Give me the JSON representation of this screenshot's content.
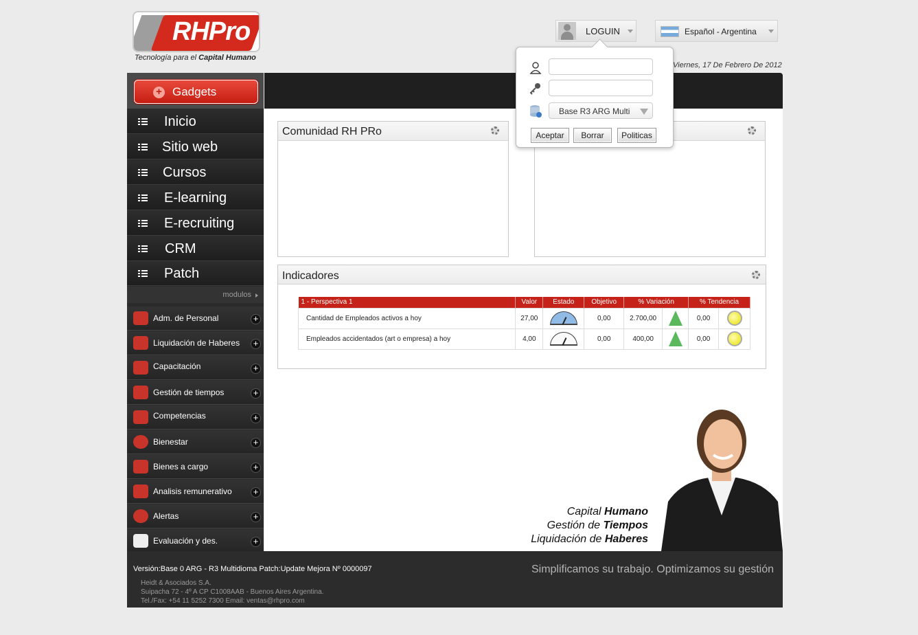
{
  "brand": {
    "logo_text": "RHPro",
    "tagline_prefix": "Tecnología para el ",
    "tagline_bold": "Capital Humano"
  },
  "header": {
    "login_label": "LOGUIN",
    "language_label": "Español - Argentina",
    "date": "Viernes, 17 De Febrero De 2012"
  },
  "login_popup": {
    "user_placeholder": "",
    "password_placeholder": "",
    "database_selected": "Base R3 ARG Multi",
    "accept_label": "Aceptar",
    "clear_label": "Borrar",
    "policies_label": "Politicas"
  },
  "sidebar": {
    "gadgets_label": "Gadgets",
    "nav": [
      {
        "label": "Inicio"
      },
      {
        "label": "Sitio web"
      },
      {
        "label": "Cursos"
      },
      {
        "label": "E-learning"
      },
      {
        "label": "E-recruiting"
      },
      {
        "label": "CRM"
      },
      {
        "label": "Patch"
      }
    ],
    "modulos_label": "modulos",
    "modules": [
      {
        "label": "Adm. de Personal",
        "icon": "people-icon"
      },
      {
        "label": "Liquidación de Haberes",
        "icon": "dollar-icon"
      },
      {
        "label": "Capacitación",
        "icon": "presentation-icon"
      },
      {
        "label": "Gestión de tiempos",
        "icon": "clock-icon"
      },
      {
        "label": "Competencias",
        "icon": "runner-icon"
      },
      {
        "label": "Bienestar",
        "icon": "lifebuoy-icon"
      },
      {
        "label": "Bienes a cargo",
        "icon": "phone-icon"
      },
      {
        "label": "Analisis remunerativo",
        "icon": "chart-icon"
      },
      {
        "label": "Alertas",
        "icon": "alarm-icon"
      },
      {
        "label": "Evaluación y des.",
        "icon": "checklist-icon"
      }
    ]
  },
  "panels": {
    "community_title": "Comunidad RH PRo",
    "indicators_title": "Indicadores"
  },
  "indicators": {
    "headers": [
      "1 - Perspectiva 1",
      "Valor",
      "Estado",
      "Objetivo",
      "% Variación",
      "% Tendencia"
    ],
    "rows": [
      {
        "desc": "Cantidad de Empleados activos a hoy",
        "valor": "27,00",
        "estado": "gauge-blue",
        "objetivo": "0,00",
        "variacion": "2.700,00",
        "tendencia": "0,00"
      },
      {
        "desc": "Empleados accidentados (art o empresa) a hoy",
        "valor": "4,00",
        "estado": "gauge-white",
        "objetivo": "0,00",
        "variacion": "400,00",
        "tendencia": "0,00"
      }
    ]
  },
  "promo": {
    "line1_a": "Capital ",
    "line1_b": "Humano",
    "line2_a": "Gestión de ",
    "line2_b": "Tiempos",
    "line3_a": "Liquidación de ",
    "line3_b": "Haberes"
  },
  "footer": {
    "version": "Versión:Base 0 ARG - R3 Multidioma   Patch:Update Mejora Nº 0000097",
    "slogan": "Simplificamos su trabajo. Optimizamos su gestión",
    "company": "Heidt & Asociados S.A.",
    "address": "Suipacha 72 - 4º A CP C1008AAB - Buenos Aires Argentina.",
    "contact": "Tel./Fax: +54 11 5252 7300    Email: ventas@rhpro.com"
  }
}
